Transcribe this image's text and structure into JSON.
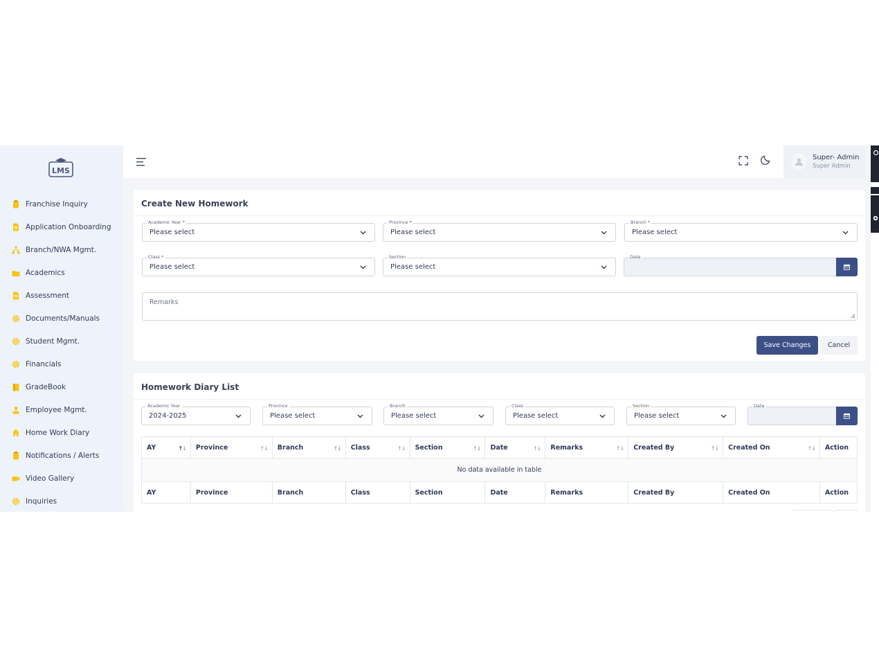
{
  "app": {
    "logo_text": "LMS"
  },
  "sidebar": {
    "items": [
      {
        "label": "Franchise Inquiry",
        "icon": "clipboard-icon"
      },
      {
        "label": "Application Onboarding",
        "icon": "file-icon"
      },
      {
        "label": "Branch/NWA Mgmt.",
        "icon": "sitemap-icon"
      },
      {
        "label": "Academics",
        "icon": "folder-icon"
      },
      {
        "label": "Assessment",
        "icon": "file-icon"
      },
      {
        "label": "Documents/Manuals",
        "icon": "gear-icon"
      },
      {
        "label": "Student Mgmt.",
        "icon": "gear-icon"
      },
      {
        "label": "Financials",
        "icon": "gear-icon"
      },
      {
        "label": "GradeBook",
        "icon": "book-icon"
      },
      {
        "label": "Employee Mgmt.",
        "icon": "user-icon"
      },
      {
        "label": "Home Work Diary",
        "icon": "home-icon"
      },
      {
        "label": "Notifications / Alerts",
        "icon": "clipboard-icon"
      },
      {
        "label": "Video Gallery",
        "icon": "video-icon"
      },
      {
        "label": "Inquiries",
        "icon": "gear-icon"
      }
    ],
    "icon_color": "#f5c518"
  },
  "header": {
    "user_name": "Super- Admin",
    "user_role": "Super Admin"
  },
  "create_form": {
    "title": "Create New Homework",
    "academic_year": {
      "label": "Academic Year *",
      "value": "Please select"
    },
    "province": {
      "label": "Province *",
      "value": "Please select"
    },
    "branch": {
      "label": "Branch *",
      "value": "Please select"
    },
    "class": {
      "label": "Class *",
      "value": "Please select"
    },
    "section": {
      "label": "Section",
      "value": "Please select"
    },
    "date": {
      "label": "Date",
      "value": ""
    },
    "remarks_placeholder": "Remarks",
    "save_label": "Save Changes",
    "cancel_label": "Cancel"
  },
  "diary_list": {
    "title": "Homework Diary List",
    "filters": {
      "academic_year": {
        "label": "Academic Year",
        "value": "2024-2025"
      },
      "province": {
        "label": "Province",
        "value": "Please select"
      },
      "branch": {
        "label": "Branch",
        "value": "Please select"
      },
      "class": {
        "label": "Class",
        "value": "Please select"
      },
      "section": {
        "label": "Section",
        "value": "Please select"
      },
      "date": {
        "label": "Date",
        "value": ""
      }
    },
    "columns": [
      "AY",
      "Province",
      "Branch",
      "Class",
      "Section",
      "Date",
      "Remarks",
      "Created By",
      "Created On",
      "Action"
    ],
    "empty_message": "No data available in table"
  },
  "colors": {
    "primary": "#3c4f86",
    "sidebar_bg": "#eef3fb",
    "page_bg": "#f3f5f8"
  }
}
